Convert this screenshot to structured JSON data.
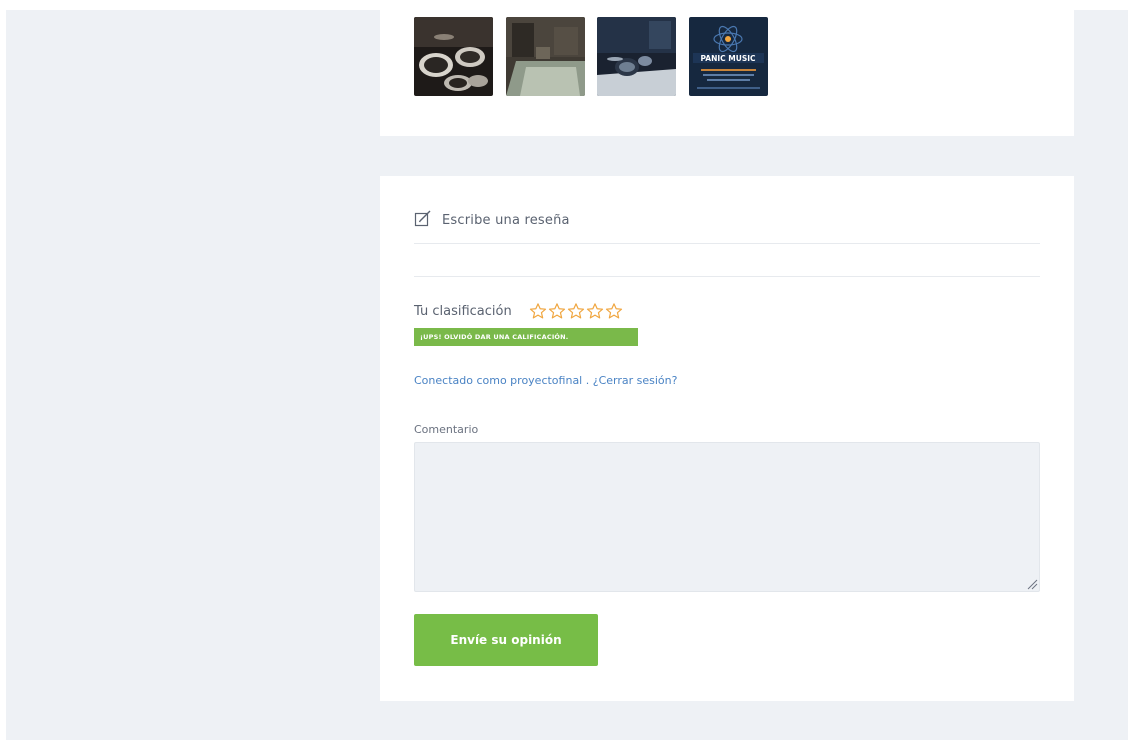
{
  "gallery": {
    "images": [
      {
        "name": "drum-kit-photo"
      },
      {
        "name": "studio-room-photo"
      },
      {
        "name": "studio-drums-photo"
      },
      {
        "name": "panic-music-poster",
        "text": "PANIC MUSIC"
      }
    ]
  },
  "review": {
    "title": "Escribe una reseña",
    "rating_label": "Tu clasificación",
    "star_count": 5,
    "error_message": "¡UPS! OLVIDÓ DAR UNA CALIFICACIÓN.",
    "logged_in_text": "Conectado como proyectofinal",
    "logout_link": ". ¿Cerrar sesión?",
    "comment_label": "Comentario",
    "comment_value": "",
    "submit_label": "Envíe su opinión"
  },
  "colors": {
    "page_background": "#eef1f5",
    "accent_green": "#77bd47",
    "star_orange": "#f0a640",
    "link_blue": "#4a83c4"
  },
  "icons": {
    "write_review": "edit-icon",
    "star": "star-outline-icon",
    "resize": "resize-grip-icon"
  }
}
